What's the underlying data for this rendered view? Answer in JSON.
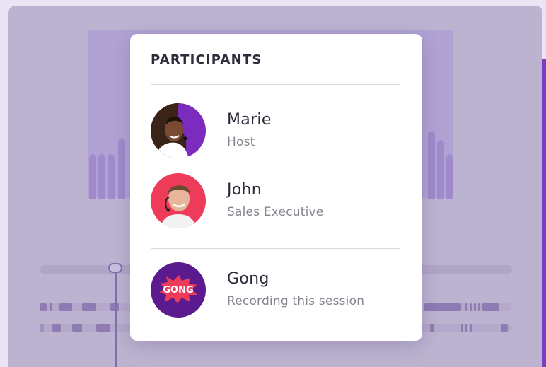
{
  "participants_panel": {
    "title": "PARTICIPANTS",
    "participants": [
      {
        "name": "Marie",
        "role": "Host",
        "avatar_color": "#7b2cbf"
      },
      {
        "name": "John",
        "role": "Sales Executive",
        "avatar_color": "#ef3b5a"
      },
      {
        "name": "Gong",
        "role": "Recording this session",
        "avatar_color": "#5b1b8e"
      }
    ],
    "gong_logo_text": "GONG"
  },
  "colors": {
    "background_overlay": "#bbb3cf",
    "accent_purple": "#7a3cc0",
    "card": "#ffffff"
  }
}
